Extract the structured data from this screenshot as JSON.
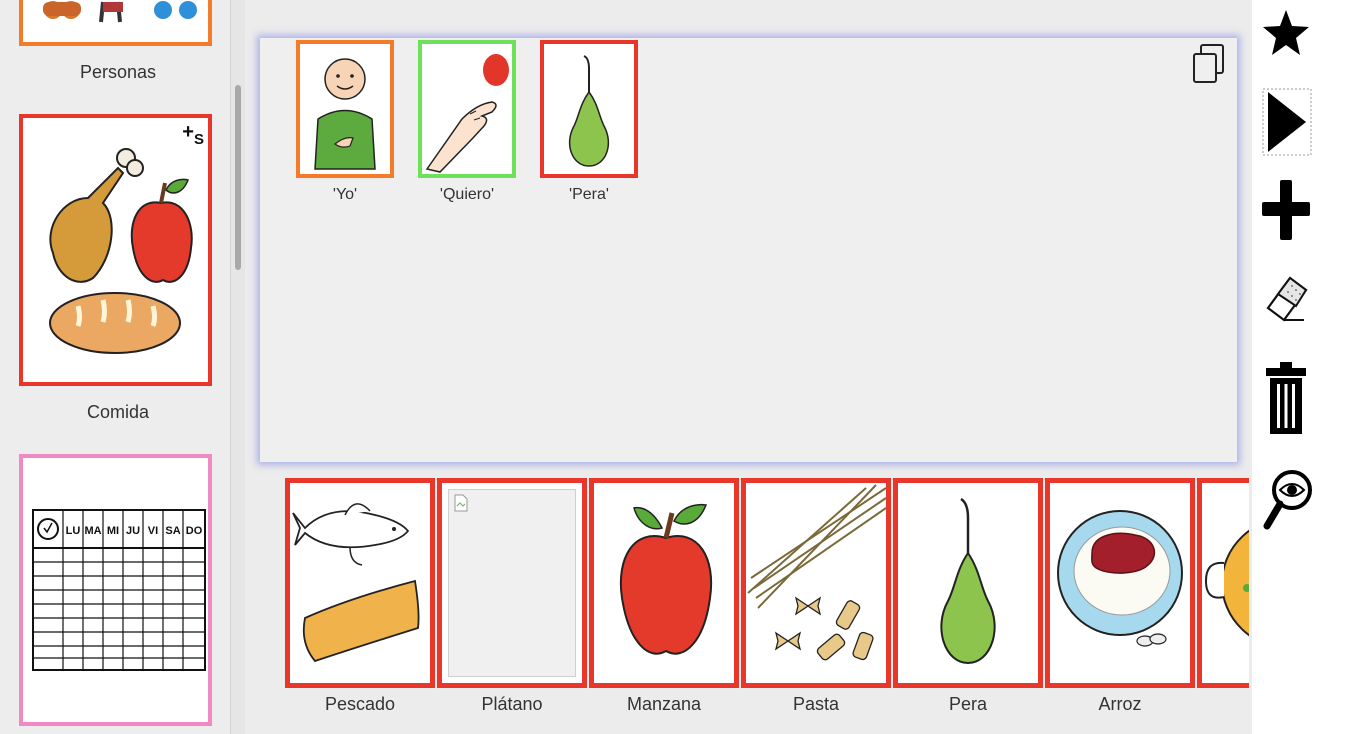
{
  "categories": [
    {
      "label": "Personas",
      "border": "#f47b2a"
    },
    {
      "label": "Comida",
      "border": "#e8372a",
      "badge": "+S"
    },
    {
      "label": "",
      "border": "#f089c4",
      "days": [
        "LU",
        "MA",
        "MI",
        "JU",
        "VI",
        "SA",
        "DO"
      ]
    }
  ],
  "sentence": [
    {
      "label": "'Yo'",
      "border": "#f47b2a",
      "icon": "person-self-icon"
    },
    {
      "label": "'Quiero'",
      "border": "#6fe05a",
      "icon": "hand-want-icon"
    },
    {
      "label": "'Pera'",
      "border": "#e8372a",
      "icon": "pear-icon"
    }
  ],
  "pictograms": [
    {
      "label": "Pescado",
      "icon": "fish-icon"
    },
    {
      "label": "Plátano",
      "icon": "broken-image-icon"
    },
    {
      "label": "Manzana",
      "icon": "apple-icon"
    },
    {
      "label": "Pasta",
      "icon": "pasta-icon"
    },
    {
      "label": "Pera",
      "icon": "pear-icon"
    },
    {
      "label": "Arroz",
      "icon": "rice-icon"
    },
    {
      "label": "",
      "icon": "paella-icon"
    }
  ],
  "toolbar": [
    {
      "icon": "star-icon"
    },
    {
      "icon": "play-icon"
    },
    {
      "icon": "plus-icon"
    },
    {
      "icon": "eraser-icon"
    },
    {
      "icon": "trash-icon"
    },
    {
      "icon": "eye-magnifier-icon"
    }
  ],
  "colors": {
    "card_red": "#e8372a",
    "card_orange": "#f47b2a",
    "card_green": "#6fe05a",
    "card_pink": "#f089c4",
    "strip_glow": "#7882e6"
  }
}
